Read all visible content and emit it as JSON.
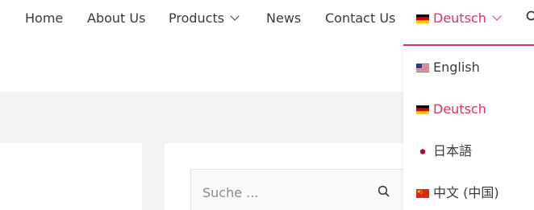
{
  "nav": {
    "items": [
      {
        "label": "Home"
      },
      {
        "label": "About Us"
      },
      {
        "label": "Products"
      },
      {
        "label": "News"
      },
      {
        "label": "Contact Us"
      }
    ],
    "language_current": "Deutsch",
    "accent_color": "#e0305f"
  },
  "language_menu": {
    "items": [
      {
        "label": "English",
        "flag": "us-flag-icon"
      },
      {
        "label": "Deutsch",
        "flag": "de-flag-icon",
        "active": true
      },
      {
        "label": "日本語",
        "flag": "jp-flag-icon"
      },
      {
        "label": "中文 (中国)",
        "flag": "cn-flag-icon"
      }
    ]
  },
  "search": {
    "placeholder": "Suche ..."
  }
}
